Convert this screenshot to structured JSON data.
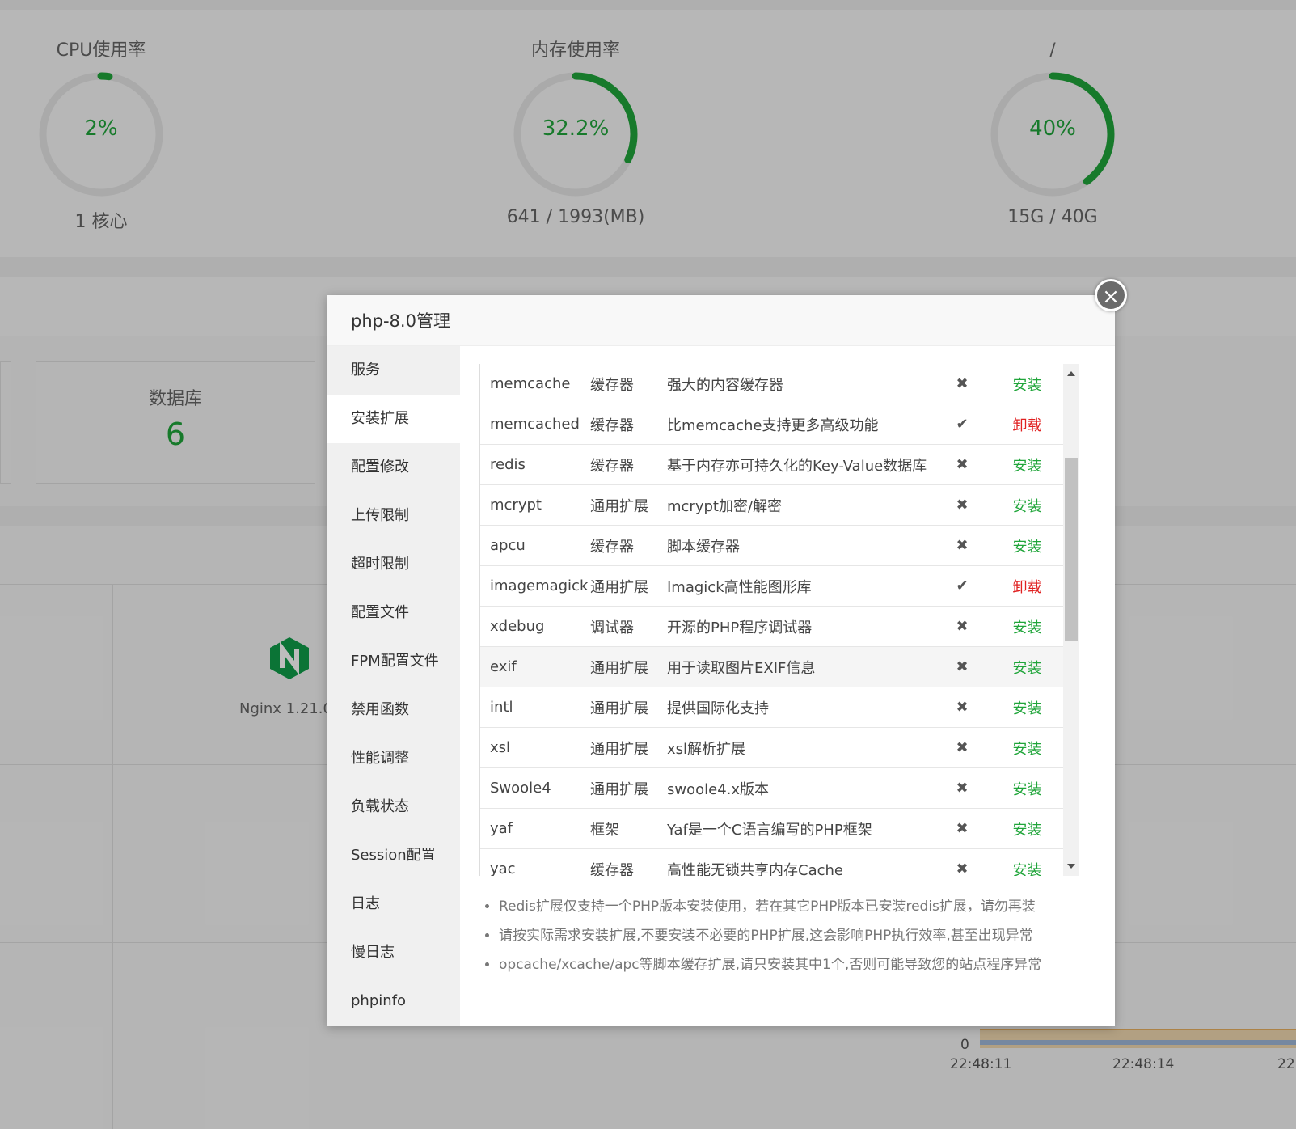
{
  "dashboard": {
    "gauges": [
      {
        "title": "CPU使用率",
        "value": "2%",
        "fraction": 0.02,
        "sub": "1 核心"
      },
      {
        "title": "内存使用率",
        "value": "32.2%",
        "fraction": 0.322,
        "sub": "641 / 1993(MB)"
      },
      {
        "title": "/",
        "value": "40%",
        "fraction": 0.4,
        "sub": "15G / 40G"
      }
    ],
    "database": {
      "label": "数据库",
      "count": "6"
    },
    "nginx": {
      "label": "Nginx 1.21.0"
    },
    "chart": {
      "y_label": "0",
      "x_labels": [
        "22:48:11",
        "22:48:14",
        "22:"
      ]
    }
  },
  "modal": {
    "title": "php-8.0管理",
    "close_icon": "×",
    "sidebar": [
      "服务",
      "安装扩展",
      "配置修改",
      "上传限制",
      "超时限制",
      "配置文件",
      "FPM配置文件",
      "禁用函数",
      "性能调整",
      "负载状态",
      "Session配置",
      "日志",
      "慢日志",
      "phpinfo"
    ],
    "active_index": 1,
    "extensions": [
      {
        "name": "memcache",
        "type": "缓存器",
        "desc": "强大的内容缓存器",
        "status": "✖",
        "action": "安装",
        "installed": false
      },
      {
        "name": "memcached",
        "type": "缓存器",
        "desc": "比memcache支持更多高级功能",
        "status": "✔",
        "action": "卸载",
        "installed": true
      },
      {
        "name": "redis",
        "type": "缓存器",
        "desc": "基于内存亦可持久化的Key-Value数据库",
        "status": "✖",
        "action": "安装",
        "installed": false
      },
      {
        "name": "mcrypt",
        "type": "通用扩展",
        "desc": "mcrypt加密/解密",
        "status": "✖",
        "action": "安装",
        "installed": false
      },
      {
        "name": "apcu",
        "type": "缓存器",
        "desc": "脚本缓存器",
        "status": "✖",
        "action": "安装",
        "installed": false
      },
      {
        "name": "imagemagick",
        "type": "通用扩展",
        "desc": "Imagick高性能图形库",
        "status": "✔",
        "action": "卸载",
        "installed": true
      },
      {
        "name": "xdebug",
        "type": "调试器",
        "desc": "开源的PHP程序调试器",
        "status": "✖",
        "action": "安装",
        "installed": false
      },
      {
        "name": "exif",
        "type": "通用扩展",
        "desc": "用于读取图片EXIF信息",
        "status": "✖",
        "action": "安装",
        "installed": false
      },
      {
        "name": "intl",
        "type": "通用扩展",
        "desc": "提供国际化支持",
        "status": "✖",
        "action": "安装",
        "installed": false
      },
      {
        "name": "xsl",
        "type": "通用扩展",
        "desc": "xsl解析扩展",
        "status": "✖",
        "action": "安装",
        "installed": false
      },
      {
        "name": "Swoole4",
        "type": "通用扩展",
        "desc": "swoole4.x版本",
        "status": "✖",
        "action": "安装",
        "installed": false
      },
      {
        "name": "yaf",
        "type": "框架",
        "desc": "Yaf是一个C语言编写的PHP框架",
        "status": "✖",
        "action": "安装",
        "installed": false
      },
      {
        "name": "yac",
        "type": "缓存器",
        "desc": "高性能无锁共享内存Cache",
        "status": "✖",
        "action": "安装",
        "installed": false
      }
    ],
    "notes": [
      "Redis扩展仅支持一个PHP版本安装使用，若在其它PHP版本已安装redis扩展，请勿再装",
      "请按实际需求安装扩展,不要安装不必要的PHP扩展,这会影响PHP执行效率,甚至出现异常",
      "opcache/xcache/apc等脚本缓存扩展,请只安装其中1个,否则可能导致您的站点程序异常"
    ],
    "colors": {
      "install": "#20a53a",
      "uninstall": "#e02020"
    }
  }
}
